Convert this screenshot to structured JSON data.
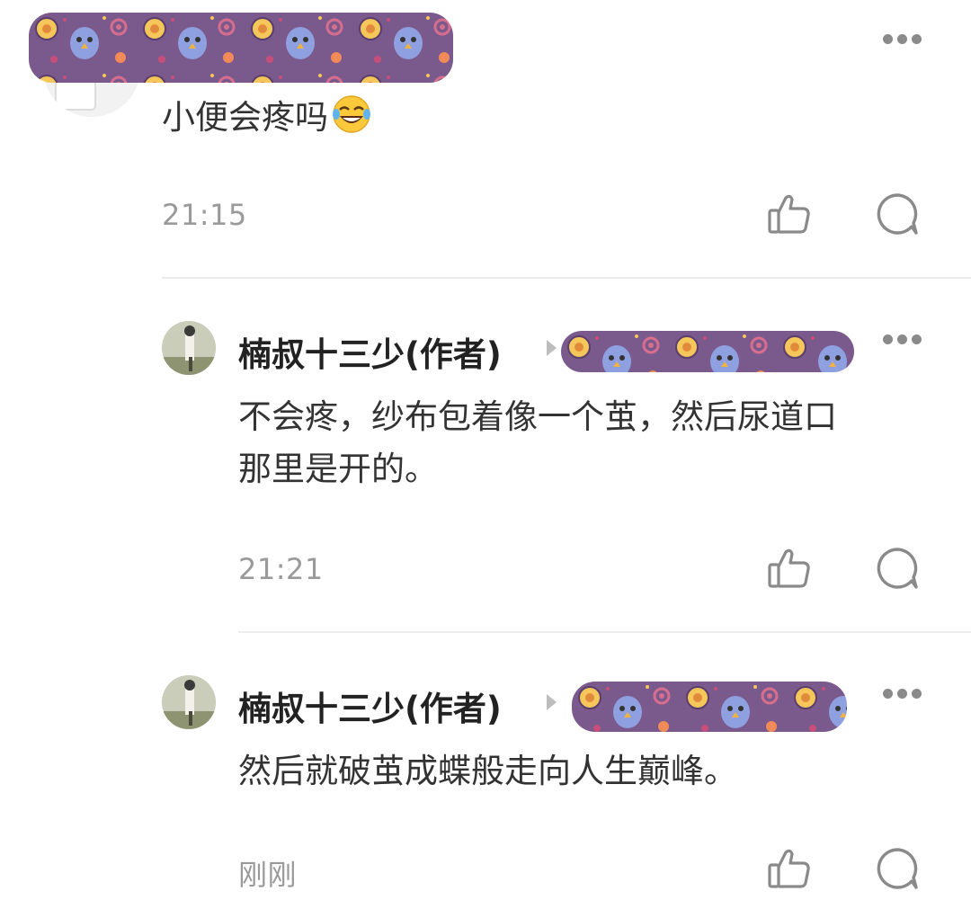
{
  "comments": [
    {
      "username_redacted": true,
      "text": "小便会疼吗",
      "emoji": "laughing-with-tears",
      "time": "21:15"
    },
    {
      "author": "楠叔十三少(作者)",
      "reply_target_redacted": true,
      "text_line1": "不会疼，纱布包着像一个茧，然后尿道口",
      "text_line2": "那里是开的。",
      "time": "21:21"
    },
    {
      "author": "楠叔十三少(作者)",
      "reply_target_redacted": true,
      "text": "然后就破茧成蝶般走向人生巅峰。",
      "time": "刚刚"
    }
  ],
  "colors": {
    "redaction": "#7a5a8c",
    "icon_gray": "#8a8a8a",
    "time_gray": "#9a9a9a"
  },
  "icons": [
    "more-icon",
    "like-icon",
    "reply-icon"
  ]
}
